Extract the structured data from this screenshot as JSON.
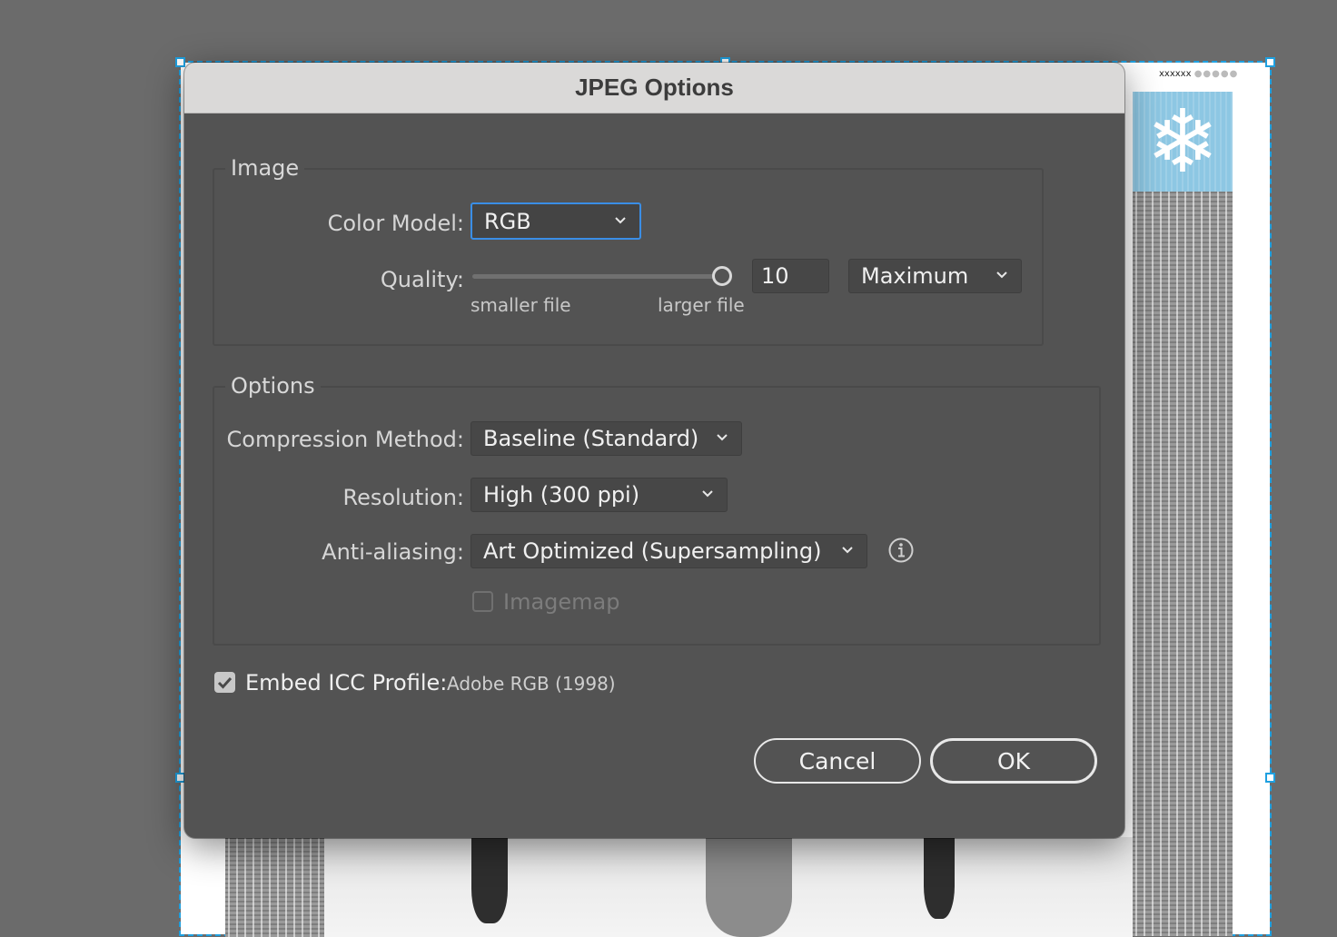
{
  "dialog": {
    "title": "JPEG Options"
  },
  "image_group": {
    "title": "Image",
    "color_model_label": "Color Model:",
    "color_model_value": "RGB",
    "quality_label": "Quality:",
    "quality_value": "10",
    "quality_level": 1.0,
    "quality_preset": "Maximum",
    "smaller_file_label": "smaller file",
    "larger_file_label": "larger file"
  },
  "options_group": {
    "title": "Options",
    "compression_label": "Compression Method:",
    "compression_value": "Baseline (Standard)",
    "resolution_label": "Resolution:",
    "resolution_value": "High (300 ppi)",
    "antialiasing_label": "Anti-aliasing:",
    "antialiasing_value": "Art Optimized (Supersampling)",
    "imagemap_label": "Imagemap",
    "imagemap_checked": false
  },
  "embed_icc": {
    "label": "Embed ICC Profile:",
    "profile": "Adobe RGB (1998)",
    "checked": true
  },
  "buttons": {
    "cancel": "Cancel",
    "ok": "OK"
  },
  "artboard": {
    "header_text": "xxxxxx",
    "header_dots": "●●●●●"
  },
  "colors": {
    "dialog_bg": "#535353",
    "titlebar_bg": "#dad9d8",
    "focus_accent": "#3a8ee6",
    "selection_blue": "#1fa0e0",
    "canvas_bg": "#6b6b6b"
  },
  "icons": [
    "chevron-down-icon",
    "info-icon",
    "checkmark-icon",
    "snowflake-icon"
  ]
}
